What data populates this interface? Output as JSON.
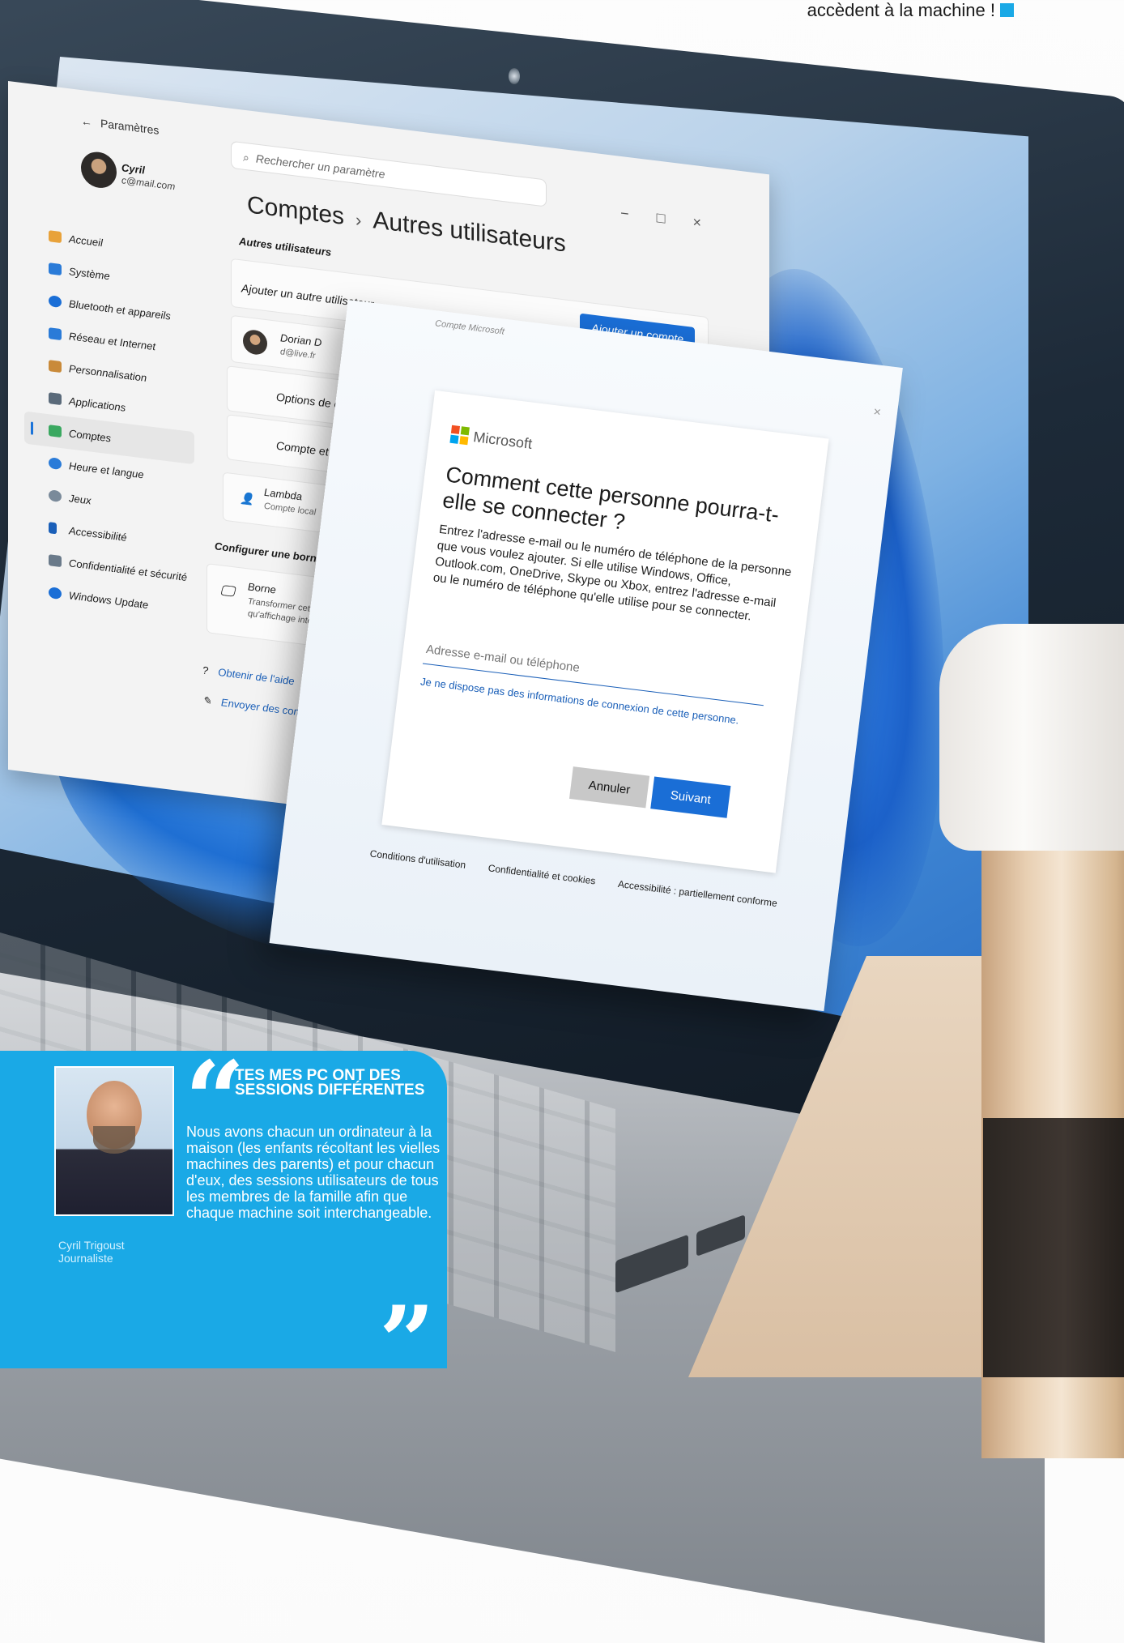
{
  "article": {
    "top_caption": "accèdent à la machine !",
    "accent_color": "#1aa9e6"
  },
  "settings": {
    "back_label": "Paramètres",
    "back_icon": "arrow-left-icon",
    "window_controls": [
      "−",
      "□",
      "×"
    ],
    "search_placeholder": "Rechercher un paramètre",
    "profile": {
      "name": "Cyril",
      "email": "c@mail.com"
    },
    "nav": [
      {
        "label": "Accueil",
        "icon": "home-icon",
        "color": "#e8a23a"
      },
      {
        "label": "Système",
        "icon": "monitor-icon",
        "color": "#2a7bd8"
      },
      {
        "label": "Bluetooth et appareils",
        "icon": "bluetooth-icon",
        "color": "#1a6ed6"
      },
      {
        "label": "Réseau et Internet",
        "icon": "wifi-icon",
        "color": "#2a7bd8"
      },
      {
        "label": "Personnalisation",
        "icon": "brush-icon",
        "color": "#c98a3a"
      },
      {
        "label": "Applications",
        "icon": "apps-icon",
        "color": "#5a6a7a"
      },
      {
        "label": "Comptes",
        "icon": "person-icon",
        "color": "#3aa860",
        "active": true
      },
      {
        "label": "Heure et langue",
        "icon": "globe-icon",
        "color": "#2a7bd8"
      },
      {
        "label": "Jeux",
        "icon": "gamepad-icon",
        "color": "#7a8a9a"
      },
      {
        "label": "Accessibilité",
        "icon": "accessibility-icon",
        "color": "#1a5fb8"
      },
      {
        "label": "Confidentialité et sécurité",
        "icon": "shield-icon",
        "color": "#6a7a8a"
      },
      {
        "label": "Windows Update",
        "icon": "update-icon",
        "color": "#1a6ed6"
      }
    ],
    "breadcrumb": {
      "parent": "Comptes",
      "separator": "›",
      "current": "Autres utilisateurs"
    },
    "section_title": "Autres utilisateurs",
    "add_user_label": "Ajouter un autre utilisateur",
    "add_account_button": "Ajouter un compte",
    "user": {
      "name": "Dorian D",
      "email": "d@live.fr"
    },
    "account_options": "Options de compte",
    "account_data": "Compte et données",
    "local_user": {
      "name": "Lambda",
      "type": "Compte local"
    },
    "kiosk_section": "Configurer une borne",
    "kiosk": {
      "name": "Borne",
      "desc": "Transformer cet appareil en kiosque pour l'utiliser en tant qu'affichage interactif ou autre chose"
    },
    "help_label": "Obtenir de l'aide",
    "feedback_label": "Envoyer des commentaires"
  },
  "ms_dialog": {
    "window_title": "Compte Microsoft",
    "close": "×",
    "brand": "Microsoft",
    "brand_colors": [
      "#f25022",
      "#7fba00",
      "#00a4ef",
      "#ffb900"
    ],
    "heading": "Comment cette personne pourra-t-elle se connecter ?",
    "description": "Entrez l'adresse e-mail ou le numéro de téléphone de la personne que vous voulez ajouter. Si elle utilise Windows, Office, Outlook.com, OneDrive, Skype ou Xbox, entrez l'adresse e-mail ou le numéro de téléphone qu'elle utilise pour se connecter.",
    "input_placeholder": "Adresse e-mail ou téléphone",
    "no_info_link": "Je ne dispose pas des informations de connexion de cette personne.",
    "cancel_button": "Annuler",
    "next_button": "Suivant",
    "footer": [
      "Conditions d'utilisation",
      "Confidentialité et cookies",
      "Accessibilité : partiellement conforme"
    ]
  },
  "quote": {
    "title": "TES MES PC ONT DES SESSIONS DIFFÉRENTES",
    "body": "Nous avons chacun un ordinateur à la maison (les enfants récoltant les vielles machines des parents) et pour chacun d'eux, des sessions utilisateurs de tous les membres de la famille afin que chaque machine soit interchangeable.",
    "author_name": "Cyril Trigoust",
    "author_role": "Journaliste"
  }
}
